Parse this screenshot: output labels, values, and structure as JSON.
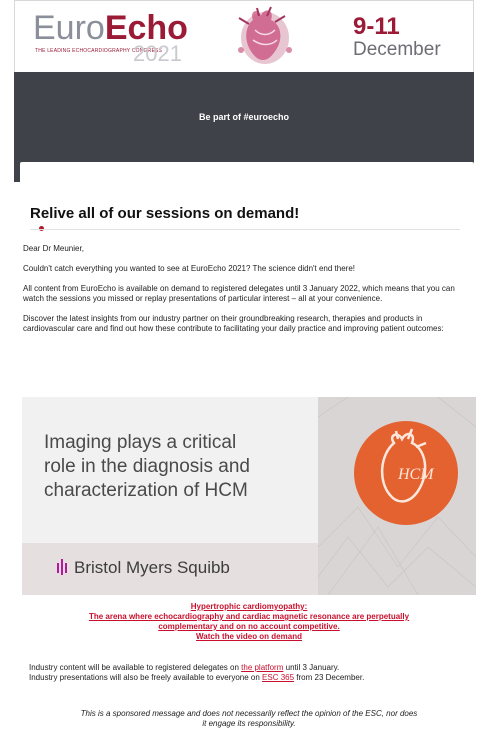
{
  "header": {
    "logo_euro": "Euro",
    "logo_echo": "Echo",
    "logo_sub": "THE LEADING ECHOCARDIOGRAPHY CONGRESS",
    "logo_year": "2021",
    "dates_num": "9-11",
    "dates_month": "December"
  },
  "band": {
    "text": "Be part of #euroecho"
  },
  "card": {
    "title": "Relive all of our sessions on demand!"
  },
  "body": {
    "greeting": "Dear Dr Meunier,",
    "p1": "Couldn't catch everything you wanted to see at EuroEcho 2021? The science didn't end there!",
    "p2": "All content from EuroEcho is available on demand to registered delegates until 3 January 2022, which means that you can watch the sessions you missed or replay presentations of particular interest – all at your convenience.",
    "p3": "Discover the latest insights from our industry partner on their groundbreaking research, therapies and products in cardiovascular care and find out how these contribute to facilitating your daily practice and improving patient outcomes:"
  },
  "banner": {
    "headline_1": "Imaging plays a critical",
    "headline_2": "role in the diagnosis and",
    "headline_3": "characterization of HCM",
    "sponsor": "Bristol Myers Squibb",
    "badge_text": "HCM",
    "accent_color": "#e4622f"
  },
  "links": {
    "l1": "Hypertrophic cardiomyopathy:",
    "l2": "The arena where echocardiography and cardiac magnetic resonance are perpetually",
    "l3": "complementary and on no account competitive.",
    "l4": "Watch the video on demand"
  },
  "info": {
    "line1_pre": "Industry content will be available to registered delegates on ",
    "line1_link": "the platform",
    "line1_post": " until 3 January.",
    "line2_pre": "Industry presentations will also be freely available to everyone on ",
    "line2_link": "ESC 365",
    "line2_post": " from 23 December."
  },
  "disclaimer": {
    "l1": "This is a sponsored message and does not necessarily reflect the opinion of the ESC, nor does",
    "l2": "it engage its responsibility."
  },
  "colors": {
    "brand": "#9b1b36",
    "link": "#c8102e",
    "band": "#3f4248"
  }
}
